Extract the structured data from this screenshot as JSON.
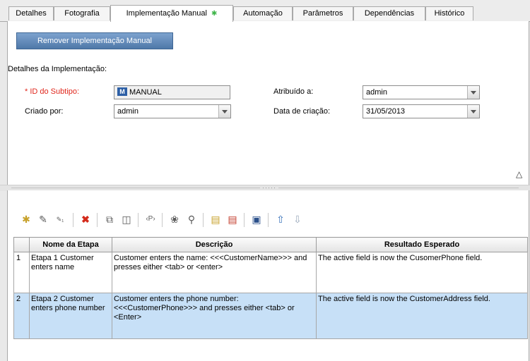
{
  "tabs": [
    {
      "label": "Detalhes"
    },
    {
      "label": "Fotografia"
    },
    {
      "label": "Implementação Manual"
    },
    {
      "label": "Automação"
    },
    {
      "label": "Parâmetros"
    },
    {
      "label": "Dependências"
    },
    {
      "label": "Histórico"
    }
  ],
  "active_tab_marker": "✱",
  "remove_button_label": "Remover Implementação Manual",
  "section_title": "Detalhes da Implementação:",
  "form": {
    "subtype_label": "* ID do Subtipo:",
    "subtype_value": "MANUAL",
    "created_by_label": "Criado por:",
    "created_by_value": "admin",
    "assigned_label": "Atribuído a:",
    "assigned_value": "admin",
    "date_label": "Data de criação:",
    "date_value": "31/05/2013"
  },
  "splitter_grip": "·····",
  "collapse_icon": "double-chevron-up-icon",
  "toolbar_icons": [
    "new-step-icon",
    "edit-step-icon",
    "renumber-steps-icon",
    "delete-icon",
    "copy-icon",
    "paste-icon",
    "insert-parameter-icon",
    "generate-script-icon",
    "find-icon",
    "select-columns-icon",
    "grid-filter-icon",
    "save-icon",
    "move-up-icon",
    "move-down-icon"
  ],
  "colors": {
    "required": "#e0261b",
    "selected_row": "#c7e0f7",
    "button": "#5b83b3",
    "active_marker": "#3fb54a"
  },
  "table": {
    "headers": [
      "Nome da Etapa",
      "Descrição",
      "Resultado Esperado"
    ],
    "rows": [
      {
        "num": "1",
        "name": "Etapa 1 Customer enters name",
        "description": "Customer enters the name: <<<CustomerName>>> and presses either <tab> or <enter>",
        "expected": "The active field is now the CusomerPhone field."
      },
      {
        "num": "2",
        "name": "Etapa 2 Customer enters phone number",
        "description": "Customer enters the phone number: <<<CustomerPhone>>> and presses either <tab> or <Enter>",
        "expected": "The active field is now the CustomerAddress field."
      }
    ]
  }
}
